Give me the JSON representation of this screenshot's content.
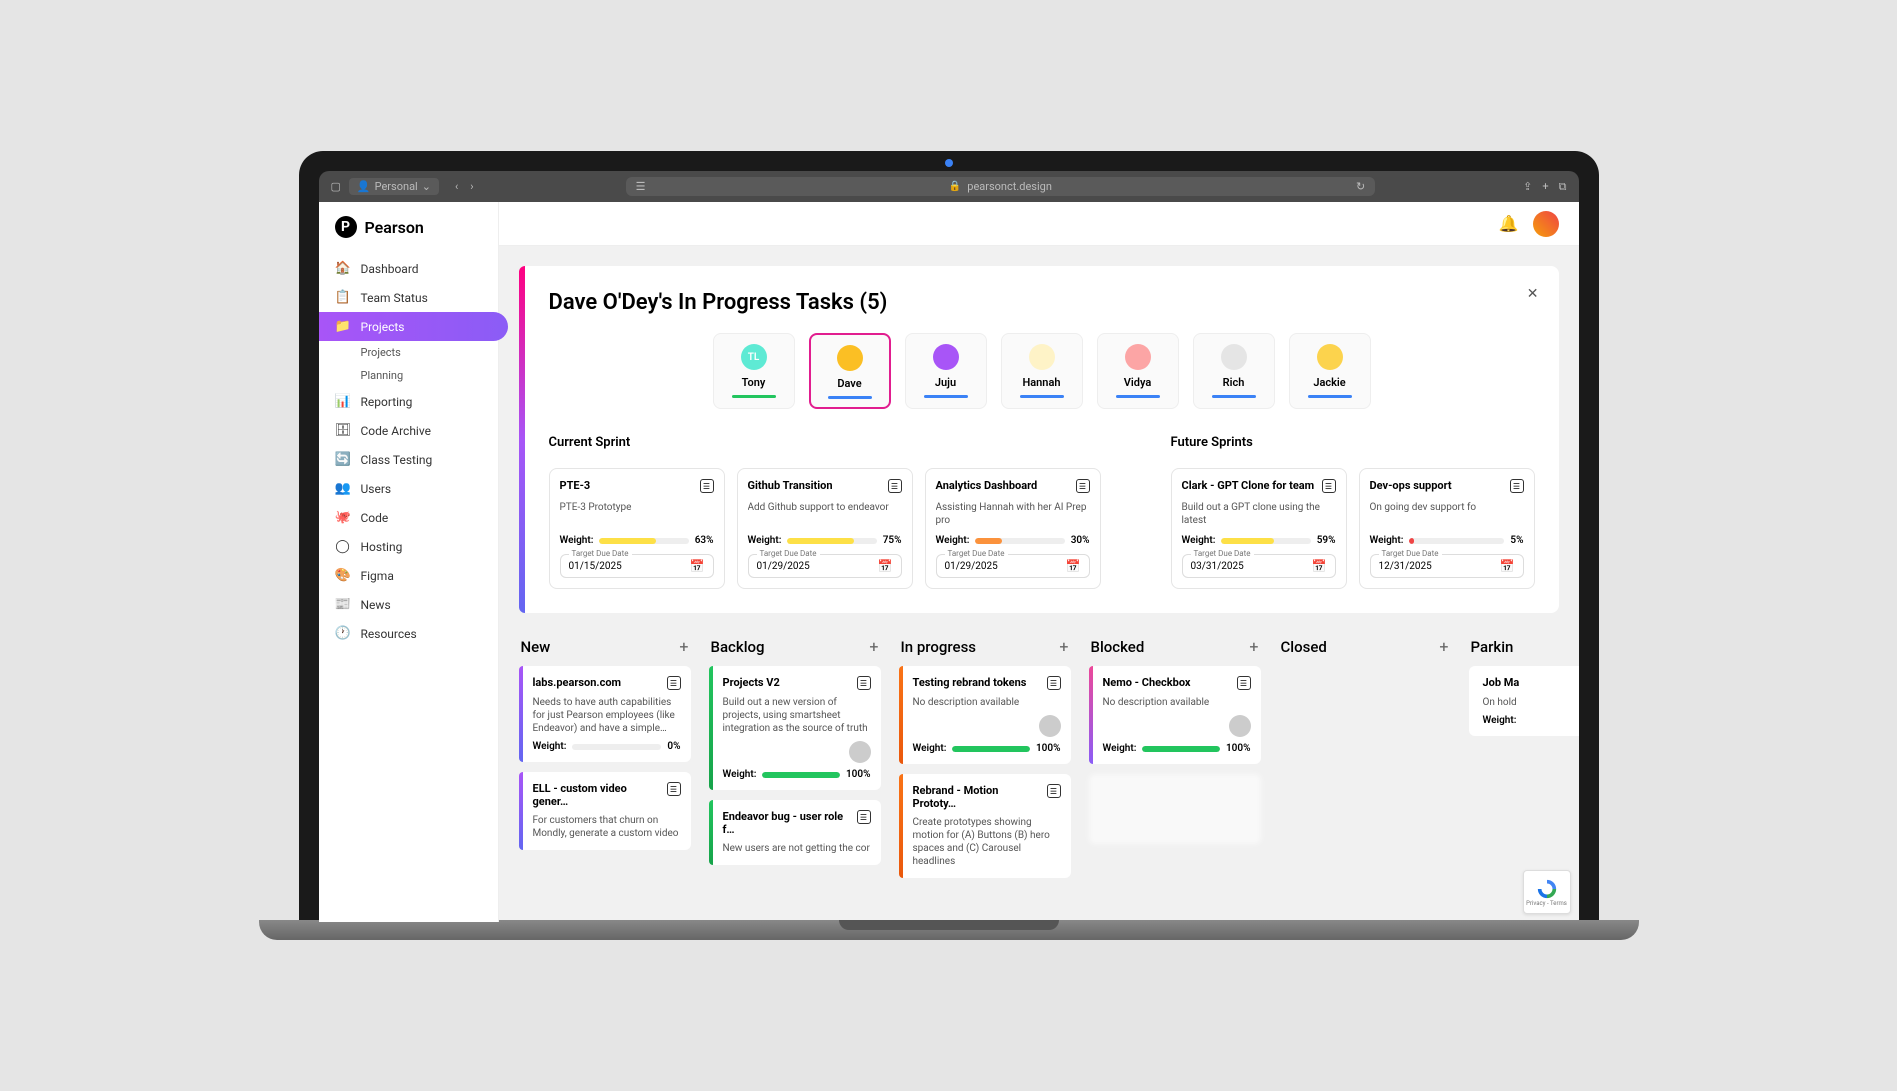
{
  "browser": {
    "profile_label": "Personal",
    "url": "pearsonct.design"
  },
  "brand": "Pearson",
  "sidebar": {
    "items": [
      {
        "label": "Dashboard",
        "icon": "🏠"
      },
      {
        "label": "Team Status",
        "icon": "📋"
      },
      {
        "label": "Projects",
        "icon": "📁",
        "active": true
      },
      {
        "label": "Reporting",
        "icon": "📊"
      },
      {
        "label": "Code Archive",
        "icon": "🗄"
      },
      {
        "label": "Class Testing",
        "icon": "🔄"
      },
      {
        "label": "Users",
        "icon": "👥"
      },
      {
        "label": "Code",
        "icon": "🐙"
      },
      {
        "label": "Hosting",
        "icon": "◯"
      },
      {
        "label": "Figma",
        "icon": "🎨"
      },
      {
        "label": "News",
        "icon": "📰"
      },
      {
        "label": "Resources",
        "icon": "🕐"
      }
    ],
    "sub": [
      "Projects",
      "Planning"
    ]
  },
  "panel": {
    "title": "Dave O'Dey's In Progress Tasks (5)",
    "people": [
      {
        "name": "Tony",
        "bar_color": "#22c55e",
        "bg": "#5eead4",
        "initials": "TL"
      },
      {
        "name": "Dave",
        "bar_color": "#3b82f6",
        "bg": "#fbbf24",
        "selected": true
      },
      {
        "name": "Juju",
        "bar_color": "#3b82f6",
        "bg": "#a855f7"
      },
      {
        "name": "Hannah",
        "bar_color": "#3b82f6",
        "bg": "#fef3c7"
      },
      {
        "name": "Vidya",
        "bar_color": "#3b82f6",
        "bg": "#fca5a5"
      },
      {
        "name": "Rich",
        "bar_color": "#3b82f6",
        "bg": "#e5e5e5"
      },
      {
        "name": "Jackie",
        "bar_color": "#3b82f6",
        "bg": "#fcd34d"
      }
    ],
    "current_label": "Current Sprint",
    "future_label": "Future Sprints",
    "current_tasks": [
      {
        "title": "PTE-3",
        "desc": "PTE-3 Prototype",
        "weight": 63,
        "color": "#fde047",
        "date": "01/15/2025"
      },
      {
        "title": "Github Transition",
        "desc": "Add Github support to endeavor",
        "weight": 75,
        "color": "#fde047",
        "date": "01/29/2025"
      },
      {
        "title": "Analytics Dashboard",
        "desc": "Assisting Hannah with her AI Prep pro",
        "weight": 30,
        "color": "#fb923c",
        "date": "01/29/2025"
      }
    ],
    "future_tasks": [
      {
        "title": "Clark - GPT Clone for team",
        "desc": "Build out a GPT clone using the latest",
        "weight": 59,
        "color": "#fde047",
        "date": "03/31/2025"
      },
      {
        "title": "Dev-ops support",
        "desc": "On going dev support fo",
        "weight": 5,
        "color": "#ef4444",
        "date": "12/31/2025"
      }
    ],
    "weight_label": "Weight:",
    "date_label": "Target Due Date"
  },
  "kanban": {
    "columns": [
      {
        "title": "New",
        "cards": [
          {
            "title": "labs.pearson.com",
            "desc": "Needs to have auth capabilities for just Pearson employees (like Endeavor) and have a simple…",
            "weight": 0,
            "stripe": "linear-gradient(180deg,#ff0080,#a855f7)"
          },
          {
            "title": "ELL - custom video gener…",
            "desc": "For customers that churn on Mondly, generate a custom video",
            "stripe": "linear-gradient(180deg,#a855f7,#6366f1)"
          }
        ]
      },
      {
        "title": "Backlog",
        "cards": [
          {
            "title": "Projects V2",
            "desc": "Build out a new version of projects, using smartsheet integration as the source of truth",
            "weight": 100,
            "avatar": true,
            "stripe": "linear-gradient(180deg,#ec4899,#8b5cf6)"
          },
          {
            "title": "Endeavor bug - user role f…",
            "desc": "New users are not getting the cor",
            "stripe": "linear-gradient(180deg,#22c55e,#16a34a)"
          }
        ]
      },
      {
        "title": "In progress",
        "cards": [
          {
            "title": "Testing rebrand tokens",
            "desc": "No description available",
            "weight": 100,
            "avatar": true,
            "stripe": "linear-gradient(180deg,#fbbf24,#f97316)"
          },
          {
            "title": "Rebrand - Motion Prototy…",
            "desc": "Create prototypes showing motion for (A) Buttons (B) hero spaces and (C) Carousel headlines",
            "stripe": "linear-gradient(180deg,#f97316,#ea580c)"
          }
        ]
      },
      {
        "title": "Blocked",
        "cards": [
          {
            "title": "Nemo - Checkbox",
            "desc": "No description available",
            "weight": 100,
            "avatar": true,
            "stripe": "linear-gradient(180deg,#ec4899,#8b5cf6)"
          },
          {
            "blur": true
          }
        ]
      },
      {
        "title": "Closed",
        "cards": []
      },
      {
        "title": "Parkin",
        "cards": [
          {
            "title": "Job Ma",
            "desc": "On hold",
            "weight_label_only": true
          }
        ]
      }
    ]
  },
  "recaptcha_label": "Privacy - Terms"
}
